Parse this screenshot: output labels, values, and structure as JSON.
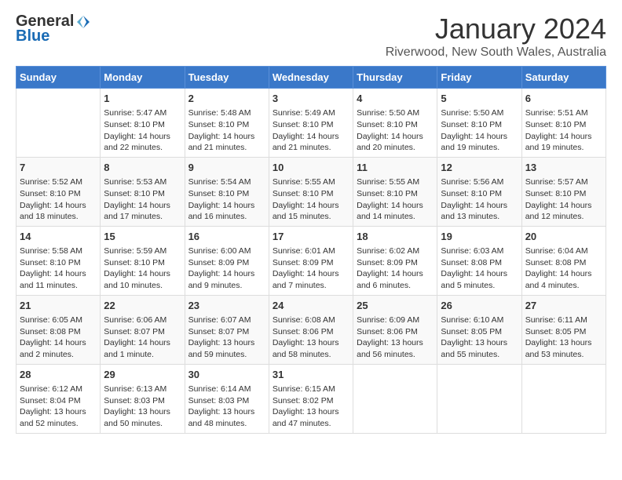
{
  "header": {
    "logo_general": "General",
    "logo_blue": "Blue",
    "month": "January 2024",
    "location": "Riverwood, New South Wales, Australia"
  },
  "days_of_week": [
    "Sunday",
    "Monday",
    "Tuesday",
    "Wednesday",
    "Thursday",
    "Friday",
    "Saturday"
  ],
  "weeks": [
    [
      {
        "day": "",
        "info": ""
      },
      {
        "day": "1",
        "info": "Sunrise: 5:47 AM\nSunset: 8:10 PM\nDaylight: 14 hours\nand 22 minutes."
      },
      {
        "day": "2",
        "info": "Sunrise: 5:48 AM\nSunset: 8:10 PM\nDaylight: 14 hours\nand 21 minutes."
      },
      {
        "day": "3",
        "info": "Sunrise: 5:49 AM\nSunset: 8:10 PM\nDaylight: 14 hours\nand 21 minutes."
      },
      {
        "day": "4",
        "info": "Sunrise: 5:50 AM\nSunset: 8:10 PM\nDaylight: 14 hours\nand 20 minutes."
      },
      {
        "day": "5",
        "info": "Sunrise: 5:50 AM\nSunset: 8:10 PM\nDaylight: 14 hours\nand 19 minutes."
      },
      {
        "day": "6",
        "info": "Sunrise: 5:51 AM\nSunset: 8:10 PM\nDaylight: 14 hours\nand 19 minutes."
      }
    ],
    [
      {
        "day": "7",
        "info": "Sunrise: 5:52 AM\nSunset: 8:10 PM\nDaylight: 14 hours\nand 18 minutes."
      },
      {
        "day": "8",
        "info": "Sunrise: 5:53 AM\nSunset: 8:10 PM\nDaylight: 14 hours\nand 17 minutes."
      },
      {
        "day": "9",
        "info": "Sunrise: 5:54 AM\nSunset: 8:10 PM\nDaylight: 14 hours\nand 16 minutes."
      },
      {
        "day": "10",
        "info": "Sunrise: 5:55 AM\nSunset: 8:10 PM\nDaylight: 14 hours\nand 15 minutes."
      },
      {
        "day": "11",
        "info": "Sunrise: 5:55 AM\nSunset: 8:10 PM\nDaylight: 14 hours\nand 14 minutes."
      },
      {
        "day": "12",
        "info": "Sunrise: 5:56 AM\nSunset: 8:10 PM\nDaylight: 14 hours\nand 13 minutes."
      },
      {
        "day": "13",
        "info": "Sunrise: 5:57 AM\nSunset: 8:10 PM\nDaylight: 14 hours\nand 12 minutes."
      }
    ],
    [
      {
        "day": "14",
        "info": "Sunrise: 5:58 AM\nSunset: 8:10 PM\nDaylight: 14 hours\nand 11 minutes."
      },
      {
        "day": "15",
        "info": "Sunrise: 5:59 AM\nSunset: 8:10 PM\nDaylight: 14 hours\nand 10 minutes."
      },
      {
        "day": "16",
        "info": "Sunrise: 6:00 AM\nSunset: 8:09 PM\nDaylight: 14 hours\nand 9 minutes."
      },
      {
        "day": "17",
        "info": "Sunrise: 6:01 AM\nSunset: 8:09 PM\nDaylight: 14 hours\nand 7 minutes."
      },
      {
        "day": "18",
        "info": "Sunrise: 6:02 AM\nSunset: 8:09 PM\nDaylight: 14 hours\nand 6 minutes."
      },
      {
        "day": "19",
        "info": "Sunrise: 6:03 AM\nSunset: 8:08 PM\nDaylight: 14 hours\nand 5 minutes."
      },
      {
        "day": "20",
        "info": "Sunrise: 6:04 AM\nSunset: 8:08 PM\nDaylight: 14 hours\nand 4 minutes."
      }
    ],
    [
      {
        "day": "21",
        "info": "Sunrise: 6:05 AM\nSunset: 8:08 PM\nDaylight: 14 hours\nand 2 minutes."
      },
      {
        "day": "22",
        "info": "Sunrise: 6:06 AM\nSunset: 8:07 PM\nDaylight: 14 hours\nand 1 minute."
      },
      {
        "day": "23",
        "info": "Sunrise: 6:07 AM\nSunset: 8:07 PM\nDaylight: 13 hours\nand 59 minutes."
      },
      {
        "day": "24",
        "info": "Sunrise: 6:08 AM\nSunset: 8:06 PM\nDaylight: 13 hours\nand 58 minutes."
      },
      {
        "day": "25",
        "info": "Sunrise: 6:09 AM\nSunset: 8:06 PM\nDaylight: 13 hours\nand 56 minutes."
      },
      {
        "day": "26",
        "info": "Sunrise: 6:10 AM\nSunset: 8:05 PM\nDaylight: 13 hours\nand 55 minutes."
      },
      {
        "day": "27",
        "info": "Sunrise: 6:11 AM\nSunset: 8:05 PM\nDaylight: 13 hours\nand 53 minutes."
      }
    ],
    [
      {
        "day": "28",
        "info": "Sunrise: 6:12 AM\nSunset: 8:04 PM\nDaylight: 13 hours\nand 52 minutes."
      },
      {
        "day": "29",
        "info": "Sunrise: 6:13 AM\nSunset: 8:03 PM\nDaylight: 13 hours\nand 50 minutes."
      },
      {
        "day": "30",
        "info": "Sunrise: 6:14 AM\nSunset: 8:03 PM\nDaylight: 13 hours\nand 48 minutes."
      },
      {
        "day": "31",
        "info": "Sunrise: 6:15 AM\nSunset: 8:02 PM\nDaylight: 13 hours\nand 47 minutes."
      },
      {
        "day": "",
        "info": ""
      },
      {
        "day": "",
        "info": ""
      },
      {
        "day": "",
        "info": ""
      }
    ]
  ]
}
